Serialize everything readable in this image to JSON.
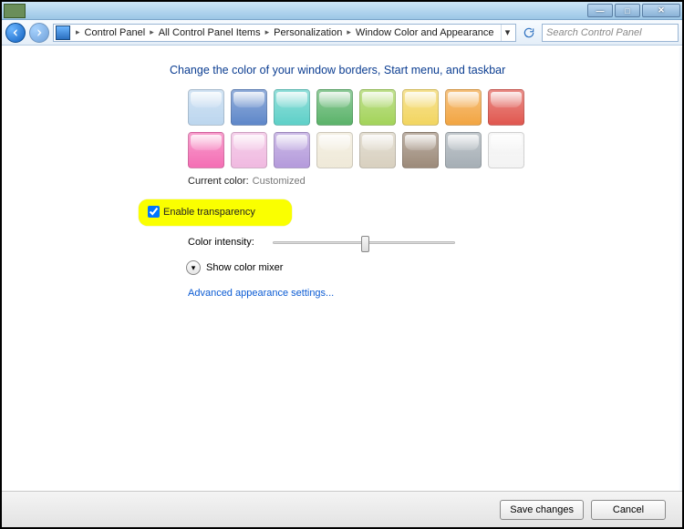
{
  "titlebar": {
    "min_tip": "Minimize",
    "max_tip": "Maximize",
    "close_tip": "Close"
  },
  "breadcrumb": {
    "items": [
      "Control Panel",
      "All Control Panel Items",
      "Personalization",
      "Window Color and Appearance"
    ]
  },
  "search": {
    "placeholder": "Search Control Panel"
  },
  "heading": "Change the color of your window borders, Start menu, and taskbar",
  "swatch_rows": [
    [
      "#bcd6ee",
      "#5e87c9",
      "#5ed0c8",
      "#5bb36a",
      "#a3d35a",
      "#f2d560",
      "#f2a542",
      "#e0574f"
    ],
    [
      "#f46eb4",
      "#f0b9e0",
      "#b49adb",
      "#efe9d8",
      "#d8d0bf",
      "#9c8a79",
      "#a5aeb5",
      "#f3f3f3"
    ]
  ],
  "current_color": {
    "label": "Current color:",
    "value": "Customized"
  },
  "transparency": {
    "label": "Enable transparency",
    "checked": true
  },
  "intensity": {
    "label": "Color intensity:",
    "value_pct": 50
  },
  "mixer": {
    "label": "Show color mixer"
  },
  "advanced_link": "Advanced appearance settings...",
  "buttons": {
    "save": "Save changes",
    "cancel": "Cancel"
  }
}
